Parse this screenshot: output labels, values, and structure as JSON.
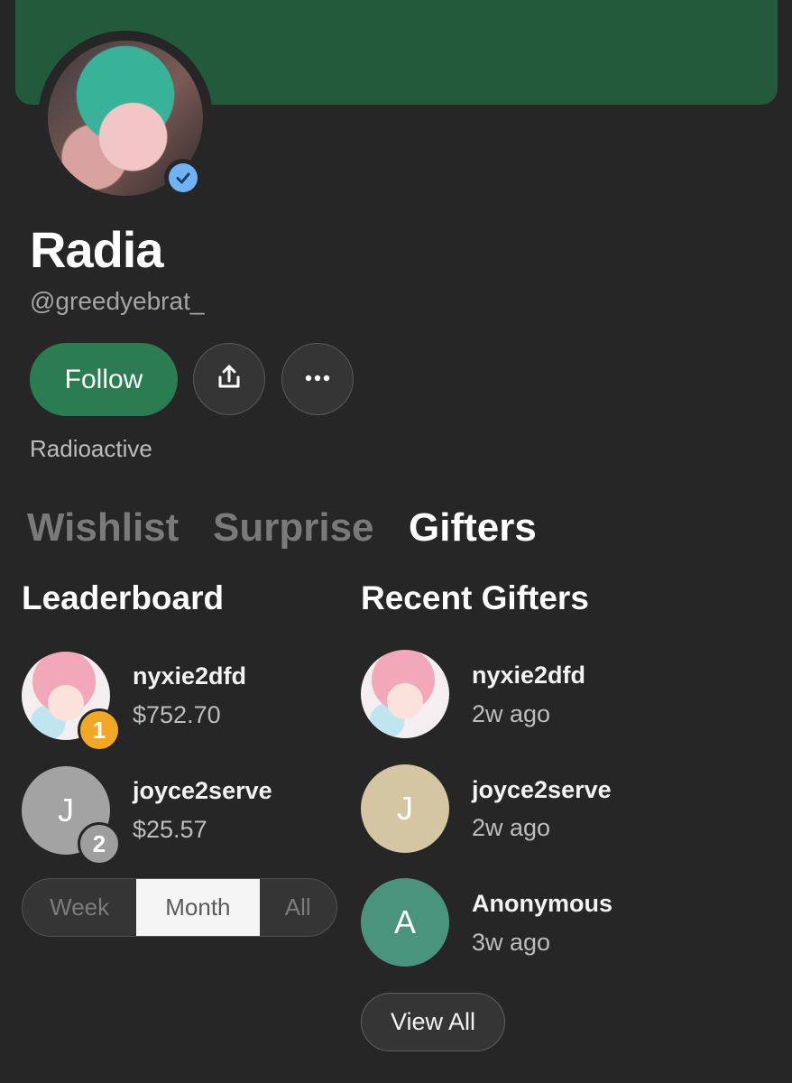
{
  "profile": {
    "name": "Radia",
    "handle": "@greedyebrat_",
    "bio": "Radioactive",
    "follow_label": "Follow"
  },
  "tabs": [
    {
      "label": "Wishlist",
      "active": false
    },
    {
      "label": "Surprise",
      "active": false
    },
    {
      "label": "Gifters",
      "active": true
    }
  ],
  "leaderboard": {
    "title": "Leaderboard",
    "entries": [
      {
        "rank": "1",
        "username": "nyxie2dfd",
        "amount": "$752.70",
        "initial": "",
        "rank_color": "#f2a825"
      },
      {
        "rank": "2",
        "username": "joyce2serve",
        "amount": "$25.57",
        "initial": "J",
        "rank_color": "#9e9e9e"
      }
    ],
    "periods": [
      "Week",
      "Month",
      "All"
    ],
    "selected_period": "Month"
  },
  "recent": {
    "title": "Recent Gifters",
    "entries": [
      {
        "username": "nyxie2dfd",
        "time": "2w ago",
        "initial": ""
      },
      {
        "username": "joyce2serve",
        "time": "2w ago",
        "initial": "J",
        "color": "#d4c5a3"
      },
      {
        "username": "Anonymous",
        "time": "3w ago",
        "initial": "A",
        "color": "#4a937c"
      }
    ],
    "view_all_label": "View All"
  },
  "colors": {
    "banner": "#235a3b",
    "follow": "#2c7c51",
    "verified": "#6fb3f5",
    "background": "#262626"
  },
  "icons": {
    "share": "share-upload-icon",
    "more": "more-horizontal-icon",
    "verified": "verified-check-icon"
  }
}
